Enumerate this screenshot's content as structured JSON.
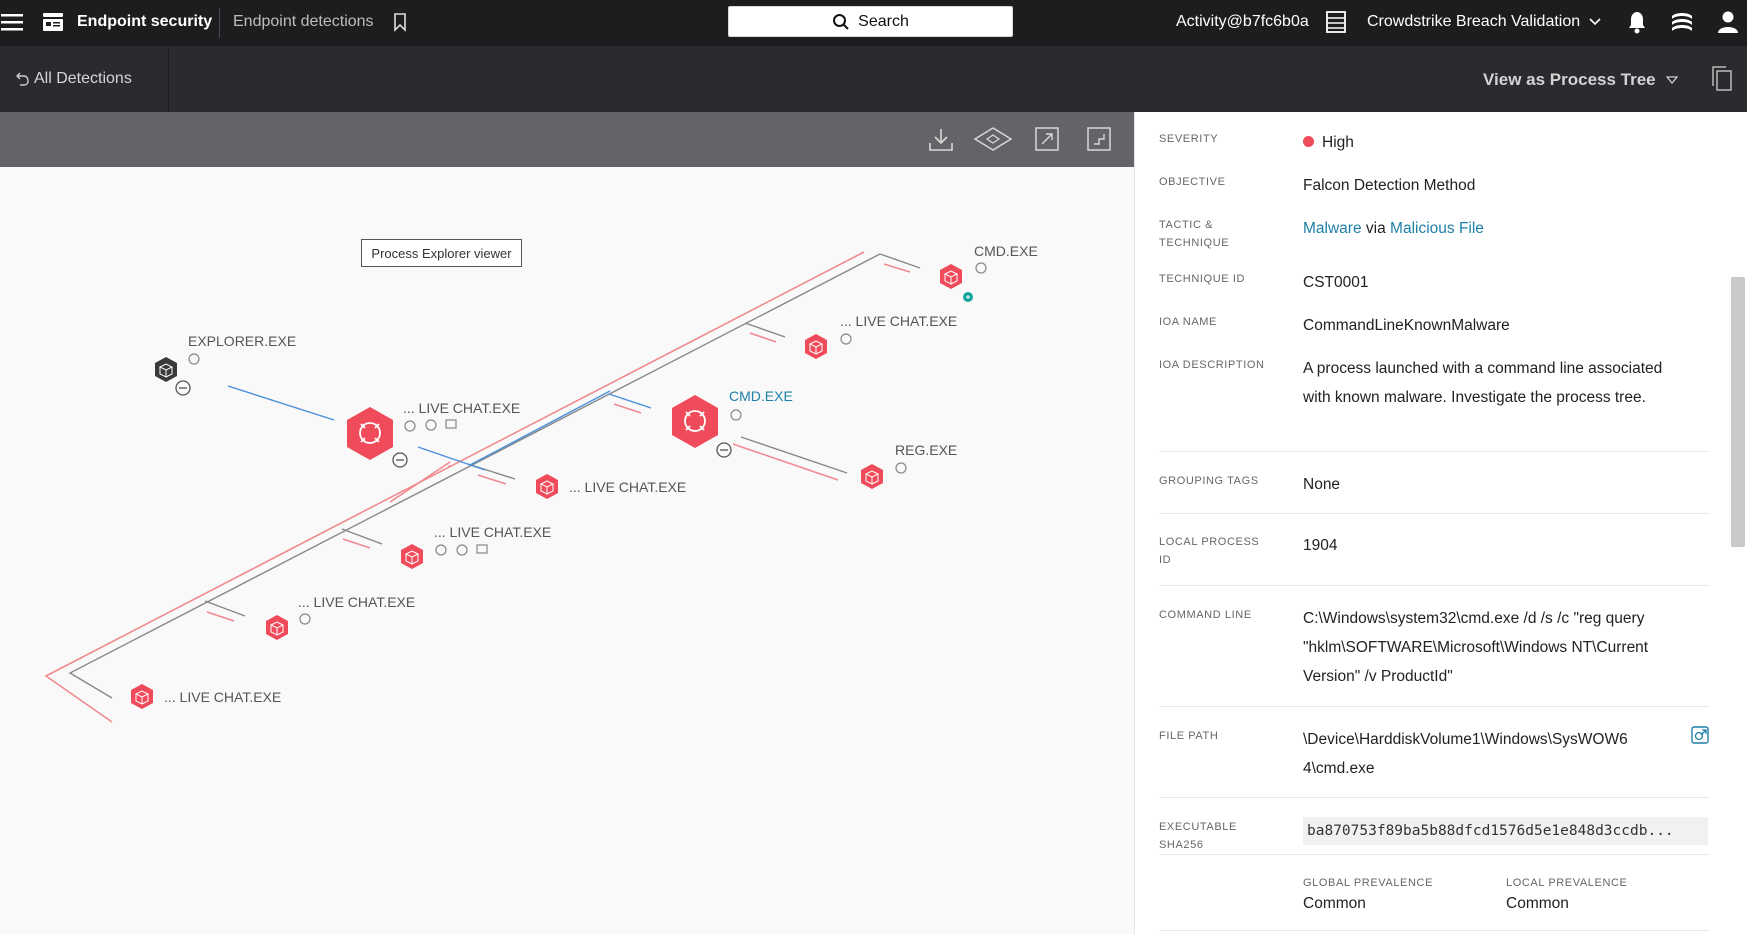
{
  "header": {
    "app_name": "Endpoint security",
    "section": "Endpoint detections",
    "search_label": "Search",
    "user": "Activity@b7fc6b0a",
    "tenant": "Crowdstrike Breach Validation",
    "icons": [
      "menu-icon",
      "app-icon",
      "bookmark-icon",
      "search-icon",
      "grid-icon",
      "chevron-down-icon",
      "bell-icon",
      "stack-icon",
      "user-icon"
    ]
  },
  "subbar": {
    "back_label": "All Detections",
    "view_label": "View as Process Tree"
  },
  "canvas": {
    "tooltip": "Process Explorer viewer",
    "nodes": {
      "explorer": "EXPLORER.EXE",
      "live_chat_main": "... LIVE CHAT.EXE",
      "live_chat_2": "... LIVE CHAT.EXE",
      "live_chat_3": "... LIVE CHAT.EXE",
      "live_chat_4": "... LIVE CHAT.EXE",
      "live_chat_5": "... LIVE CHAT.EXE",
      "live_chat_6": "... LIVE CHAT.EXE",
      "cmd_selected": "CMD.EXE",
      "cmd_top": "CMD.EXE",
      "reg": "REG.EXE"
    },
    "colors": {
      "alert": "#ef4b5b",
      "dark_node": "#3a3a3a",
      "blue_edge": "#4a8fdc",
      "teal": "#16a3a0"
    }
  },
  "details": {
    "severity": {
      "label": "SEVERITY",
      "value": "High",
      "color": "#ef4b5b"
    },
    "objective": {
      "label": "OBJECTIVE",
      "value": "Falcon Detection Method"
    },
    "tactic": {
      "label_line1": "TACTIC &",
      "label_line2": "TECHNIQUE",
      "tactic": "Malware",
      "via": "via",
      "technique": "Malicious File"
    },
    "technique_id": {
      "label": "TECHNIQUE ID",
      "value": "CST0001"
    },
    "ioa_name": {
      "label": "IOA NAME",
      "value": "CommandLineKnownMalware"
    },
    "ioa_description": {
      "label": "IOA DESCRIPTION",
      "line1": "A process launched with a command line associated",
      "line2": "with known malware. Investigate the process tree."
    },
    "grouping_tags": {
      "label": "GROUPING TAGS",
      "value": "None"
    },
    "local_process_id": {
      "label_line1": "LOCAL PROCESS",
      "label_line2": "ID",
      "value": "1904"
    },
    "command_line": {
      "label": "COMMAND LINE",
      "line1": "C:\\Windows\\system32\\cmd.exe /d /s /c \"reg query",
      "line2": "\"hklm\\SOFTWARE\\Microsoft\\Windows NT\\Current",
      "line3": "Version\" /v ProductId\""
    },
    "file_path": {
      "label": "FILE PATH",
      "line1": "\\Device\\HarddiskVolume1\\Windows\\SysWOW6",
      "line2": "4\\cmd.exe"
    },
    "sha256": {
      "label_line1": "EXECUTABLE",
      "label_line2": "SHA256",
      "value": "ba870753f89ba5b88dfcd1576d5e1e848d3ccdb..."
    },
    "global_prevalence": {
      "label": "GLOBAL PREVALENCE",
      "value": "Common"
    },
    "local_prevalence": {
      "label": "LOCAL PREVALENCE",
      "value": "Common"
    }
  }
}
